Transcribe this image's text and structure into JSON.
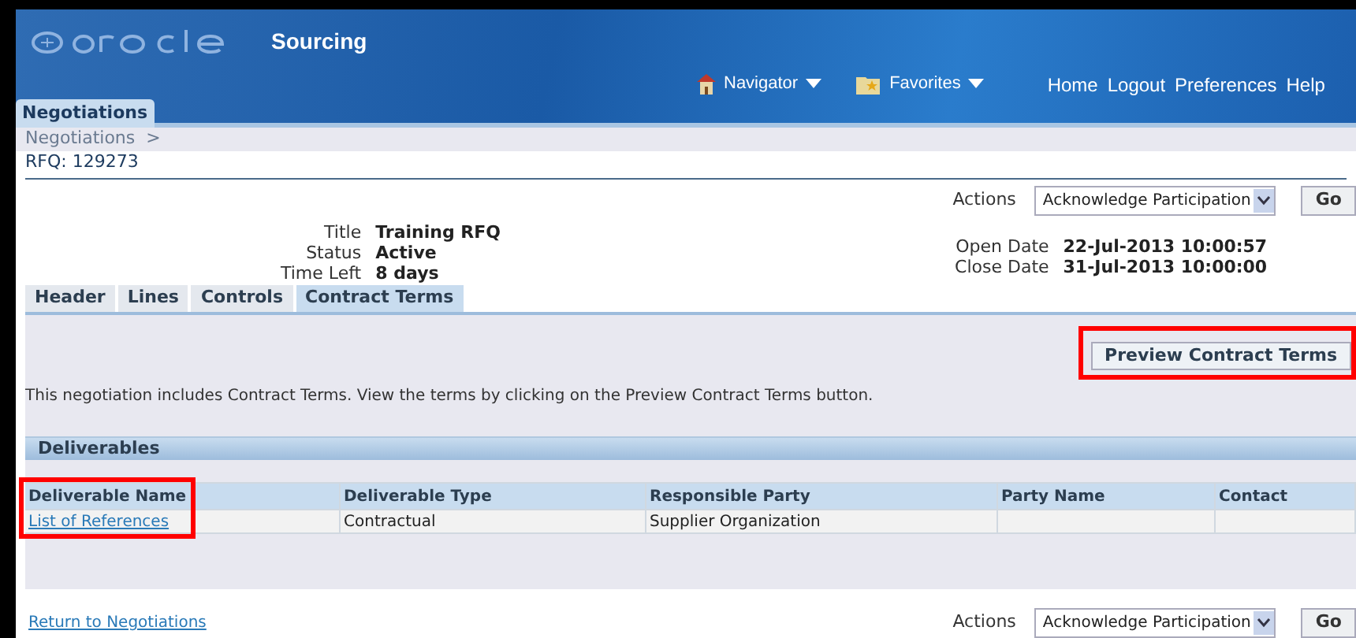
{
  "header": {
    "product": "Sourcing",
    "menus": [
      {
        "label": "Navigator",
        "kind": "home"
      },
      {
        "label": "Favorites",
        "kind": "folder"
      }
    ],
    "links": [
      "Home",
      "Logout",
      "Preferences",
      "Help"
    ]
  },
  "main_tabs": [
    {
      "label": "Negotiations",
      "selected": true
    }
  ],
  "breadcrumb": "Negotiations  >",
  "page_title": "RFQ: 129273",
  "actions_top": {
    "label": "Actions",
    "value": "Acknowledge Participation",
    "button": "Go"
  },
  "info_left": [
    {
      "label": "Title",
      "value": "Training RFQ"
    },
    {
      "label": "Status",
      "value": "Active"
    },
    {
      "label": "Time Left",
      "value": "8 days"
    }
  ],
  "info_right": [
    {
      "label": "Open Date",
      "value": "22-Jul-2013 10:00:57"
    },
    {
      "label": "Close Date",
      "value": "31-Jul-2013 10:00:00"
    }
  ],
  "tabs": [
    {
      "label": "Header",
      "selected": false
    },
    {
      "label": "Lines",
      "selected": false
    },
    {
      "label": "Controls",
      "selected": false
    },
    {
      "label": "Contract Terms",
      "selected": true
    }
  ],
  "preview_button": {
    "label": "Preview Contract Terms",
    "highlighted": true
  },
  "message": "This negotiation includes Contract Terms. View the terms by clicking on the Preview Contract Terms button.",
  "deliverables": {
    "title": "Deliverables",
    "columns": [
      "Deliverable Name",
      "Deliverable Type",
      "Responsible Party",
      "Party Name",
      "Contact"
    ],
    "rows": [
      [
        "List of References",
        "Contractual",
        "Supplier Organization",
        "",
        ""
      ]
    ],
    "name_column_highlighted": true
  },
  "return_link": "Return to Negotiations",
  "actions_bottom": {
    "label": "Actions",
    "value": "Acknowledge Participation",
    "button": "Go"
  }
}
